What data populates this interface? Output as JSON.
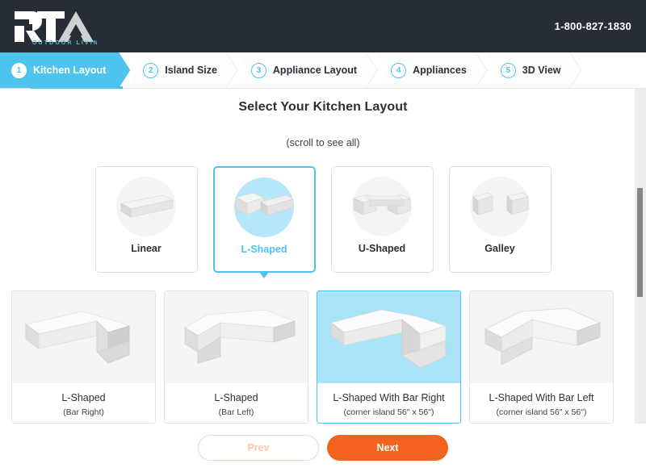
{
  "header": {
    "logo_text": "RTA",
    "logo_tagline": "OUTDOOR LIVING",
    "phone": "1-800-827-1830",
    "background_color": "#262d35"
  },
  "stepper": {
    "accent_color": "#4ec3ed",
    "steps": [
      {
        "number": "1",
        "label": "Kitchen Layout",
        "active": true
      },
      {
        "number": "2",
        "label": "Island Size",
        "active": false
      },
      {
        "number": "3",
        "label": "Appliance Layout",
        "active": false
      },
      {
        "number": "4",
        "label": "Appliances",
        "active": false
      },
      {
        "number": "5",
        "label": "3D View",
        "active": false
      }
    ]
  },
  "main": {
    "title": "Select Your Kitchen Layout",
    "scroll_hint": "(scroll to see all)",
    "layout_types": [
      {
        "label": "Linear",
        "icon": "linear-counter-icon",
        "selected": false
      },
      {
        "label": "L-Shaped",
        "icon": "l-shaped-counter-icon",
        "selected": true
      },
      {
        "label": "U-Shaped",
        "icon": "u-shaped-counter-icon",
        "selected": false
      },
      {
        "label": "Galley",
        "icon": "galley-counter-icon",
        "selected": false
      }
    ],
    "variants": [
      {
        "name": "L-Shaped",
        "sub": "(Bar Right)",
        "icon": "l-shaped-bar-right-icon",
        "selected": false
      },
      {
        "name": "L-Shaped",
        "sub": "(Bar Left)",
        "icon": "l-shaped-bar-left-icon",
        "selected": false
      },
      {
        "name": "L-Shaped With Bar Right",
        "sub": "(corner island 56\" x 56\")",
        "icon": "l-shaped-with-bar-right-icon",
        "selected": true
      },
      {
        "name": "L-Shaped With Bar Left",
        "sub": "(corner island 56\" x 56\")",
        "icon": "l-shaped-with-bar-left-icon",
        "selected": false
      }
    ]
  },
  "footer": {
    "prev_label": "Prev",
    "next_label": "Next",
    "prev_disabled": true,
    "next_color": "#f4631e"
  },
  "scrollbar": {
    "orientation": "vertical",
    "track_color": "#ededed",
    "thumb_color": "#868686"
  }
}
